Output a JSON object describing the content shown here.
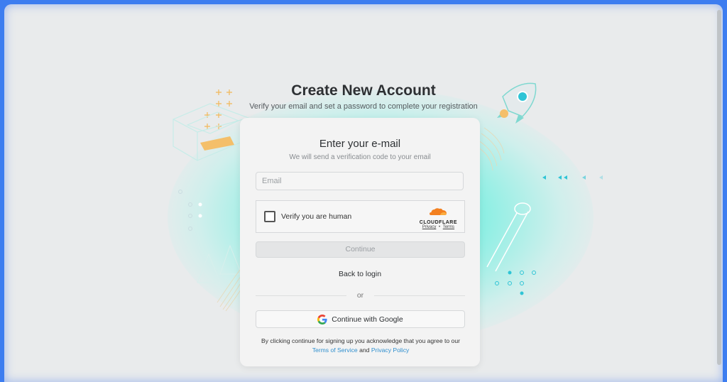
{
  "header": {
    "title": "Create New Account",
    "subtitle": "Verify your email and set a password to complete your registration"
  },
  "card": {
    "title": "Enter your e-mail",
    "subtitle": "We will send a verification code to your email",
    "email_placeholder": "Email",
    "email_value": "",
    "captcha_label": "Verify you are human",
    "captcha_brand": "CLOUDFLARE",
    "captcha_privacy": "Privacy",
    "captcha_sep": "•",
    "captcha_terms": "Terms",
    "continue_label": "Continue",
    "back_label": "Back to login",
    "or_label": "or",
    "google_label": "Continue with Google",
    "legal_prefix": "By clicking continue for signing up you acknowledge that you agree to our",
    "legal_tos": "Terms of Service",
    "legal_and": "and",
    "legal_pp": "Privacy Policy"
  },
  "colors": {
    "accent_link": "#2f8fce",
    "glow": "#6fe6dc",
    "frame_border": "#3d7df0",
    "cloudflare": "#f38020"
  },
  "icons": [
    "google-icon",
    "cloudflare-icon",
    "rocket-icon",
    "checkbox-icon"
  ]
}
